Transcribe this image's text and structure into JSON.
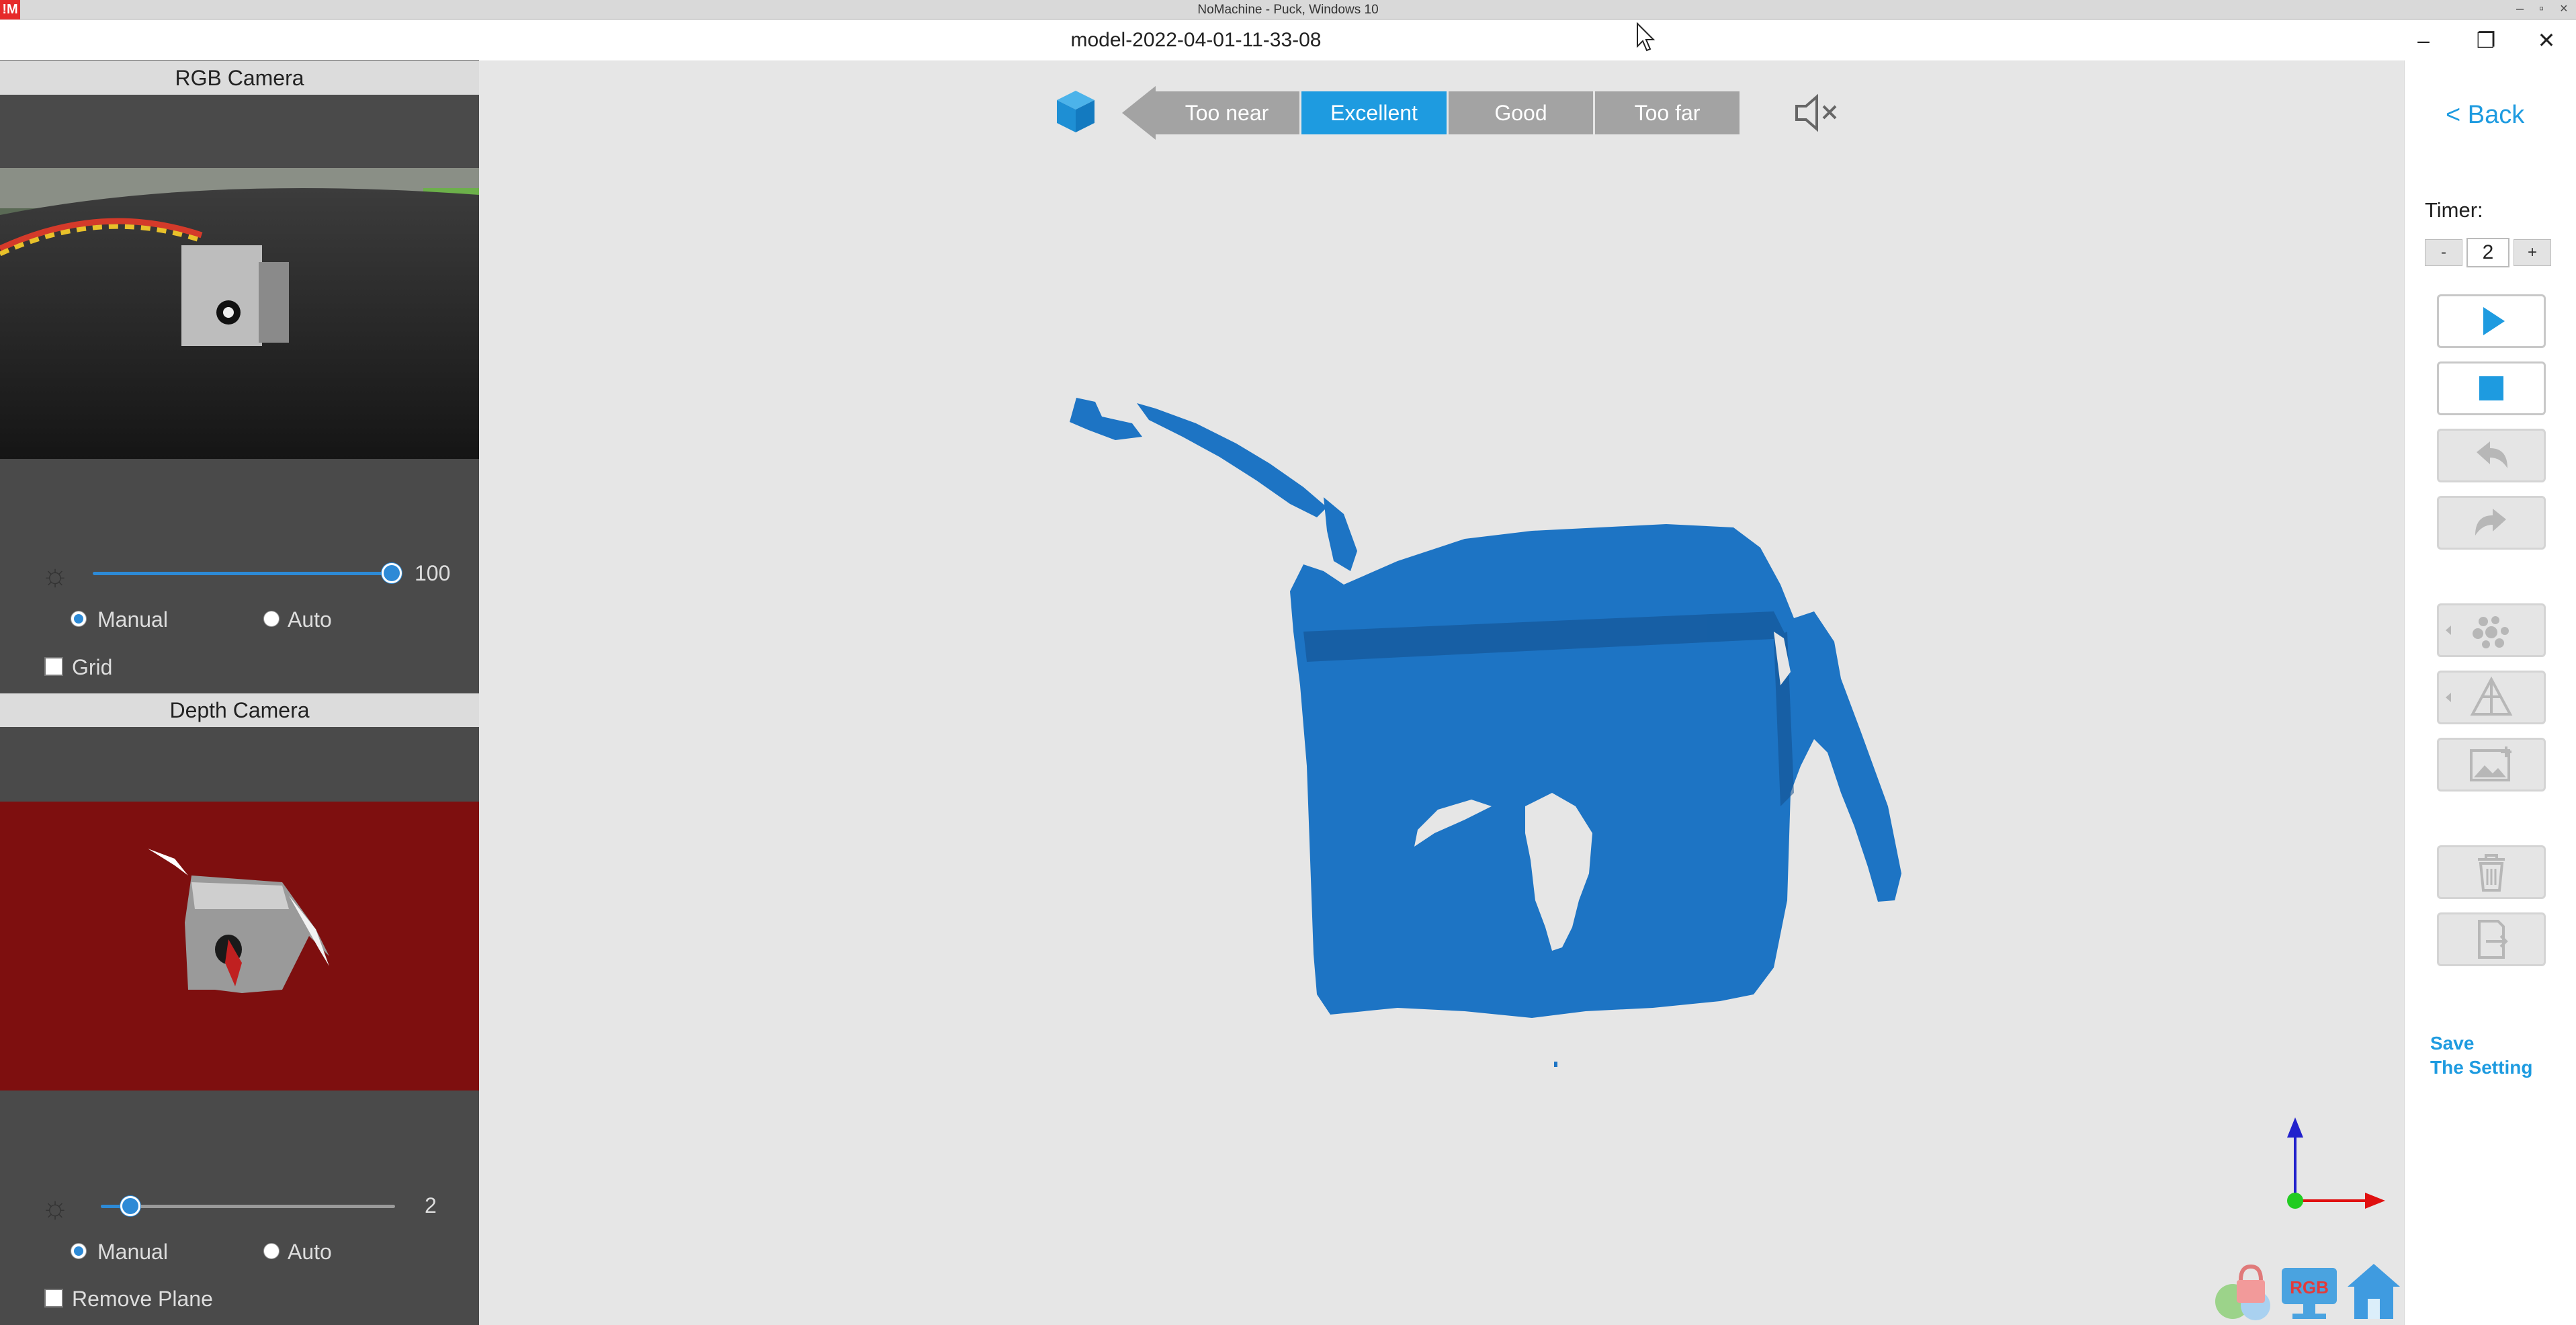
{
  "remote_bar": {
    "title": "NoMachine - Puck, Windows 10",
    "logo": "!M",
    "controls": [
      "–",
      "▫",
      "×"
    ]
  },
  "window": {
    "title": "model-2022-04-01-11-33-08",
    "controls": [
      "–",
      "❐",
      "✕"
    ]
  },
  "rgb_panel": {
    "header": "RGB Camera",
    "brightness_value": "100",
    "brightness_level": 1.0,
    "mode_manual": "Manual",
    "mode_auto": "Auto",
    "selected_mode": "Manual",
    "grid_label": "Grid",
    "grid_checked": false
  },
  "depth_panel": {
    "header": "Depth Camera",
    "brightness_value": "2",
    "brightness_level": 0.1,
    "mode_manual": "Manual",
    "mode_auto": "Auto",
    "selected_mode": "Manual",
    "remove_plane_label": "Remove Plane",
    "remove_plane_checked": false
  },
  "distance_bar": {
    "options": [
      "Too near",
      "Excellent",
      "Good",
      "Too far"
    ],
    "active": "Excellent"
  },
  "right_panel": {
    "back_label": "< Back",
    "timer_label": "Timer:",
    "timer_minus": "-",
    "timer_value": "2",
    "timer_plus": "+",
    "save_line1": "Save",
    "save_line2": "The Setting"
  },
  "icons": [
    "cube-icon",
    "mute-icon",
    "brightness-icon",
    "play-icon",
    "stop-icon",
    "undo-icon",
    "redo-icon",
    "point-cloud-icon",
    "mesh-icon",
    "add-image-icon",
    "trash-icon",
    "export-icon",
    "axis-gizmo-icon",
    "lock-icon",
    "rgb-monitor-icon",
    "home-icon"
  ],
  "colors": {
    "accent": "#1e9be0",
    "model": "#1d74c4",
    "depth_bg": "#7e0f0f",
    "axis_x": "#e01010",
    "axis_y": "#2222cc",
    "axis_origin": "#22cc22"
  }
}
